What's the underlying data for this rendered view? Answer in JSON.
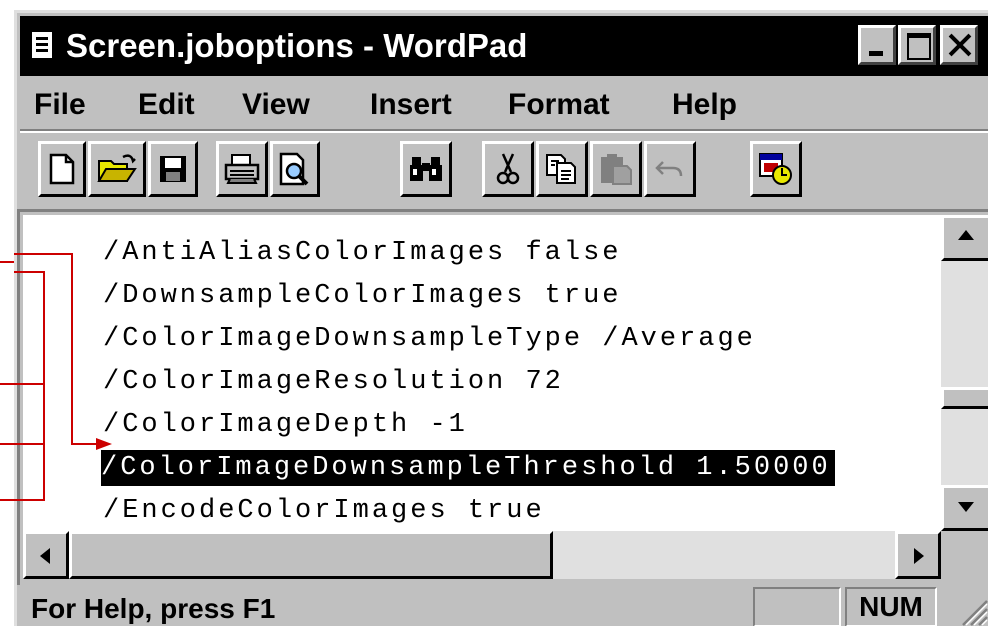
{
  "window": {
    "title": "Screen.joboptions - WordPad"
  },
  "menu": [
    "File",
    "Edit",
    "View",
    "Insert",
    "Format",
    "Help"
  ],
  "toolbar": {
    "buttons": [
      {
        "name": "new-document",
        "icon": "new-page-icon"
      },
      {
        "name": "open",
        "icon": "open-folder-icon"
      },
      {
        "name": "save",
        "icon": "floppy-disk-icon"
      },
      {
        "name": "print",
        "icon": "printer-icon"
      },
      {
        "name": "print-preview",
        "icon": "print-preview-icon"
      },
      {
        "name": "find",
        "icon": "binoculars-icon"
      },
      {
        "name": "cut",
        "icon": "scissors-icon"
      },
      {
        "name": "copy",
        "icon": "copy-icon"
      },
      {
        "name": "paste",
        "icon": "clipboard-icon",
        "disabled": true
      },
      {
        "name": "undo",
        "icon": "undo-icon",
        "disabled": true
      },
      {
        "name": "date-time",
        "icon": "calendar-clock-icon"
      }
    ]
  },
  "document": {
    "lines": [
      "/AntiAliasColorImages false",
      "/DownsampleColorImages true",
      "/ColorImageDownsampleType /Average",
      "/ColorImageResolution 72",
      "/ColorImageDepth -1",
      "/ColorImageDownsampleThreshold 1.50000",
      "/EncodeColorImages true"
    ],
    "selected_line_index": 5
  },
  "status": {
    "help_text": "For Help, press F1",
    "caps_panel": "",
    "num_panel": "NUM"
  },
  "colors": {
    "title_bar": "#000000",
    "selection": "#000000",
    "annotation_line": "#cc0000"
  }
}
